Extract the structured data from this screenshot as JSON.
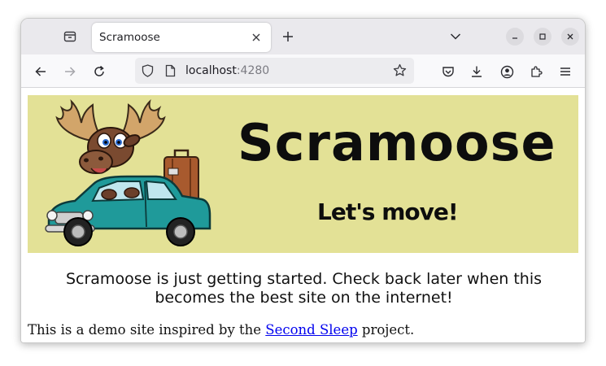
{
  "browser": {
    "tab": {
      "title": "Scramoose"
    },
    "url": {
      "host": "localhost",
      "port": ":4280"
    },
    "icons": {
      "tabs_list": "tab-list-icon",
      "close_tab": "close-icon",
      "new_tab": "plus-icon",
      "list_all_tabs": "chevron-down-icon",
      "minimize": "minimize-icon",
      "maximize": "maximize-icon",
      "close_window": "close-window-icon",
      "back": "back-arrow-icon",
      "forward": "forward-arrow-icon",
      "reload": "reload-icon",
      "security": "shield-icon",
      "page": "page-icon",
      "bookmark": "star-icon",
      "pocket": "pocket-icon",
      "downloads": "download-icon",
      "account": "account-icon",
      "extensions": "extensions-icon",
      "menu": "hamburger-menu-icon"
    }
  },
  "page": {
    "banner": {
      "title": "Scramoose",
      "tagline": "Let's move!",
      "background": "#e3e196"
    },
    "lead": "Scramoose is just getting started. Check back later when this becomes the best site on the internet!",
    "note": {
      "prefix": "This is a demo site inspired by the ",
      "link_text": "Second Sleep",
      "suffix": " project."
    }
  }
}
